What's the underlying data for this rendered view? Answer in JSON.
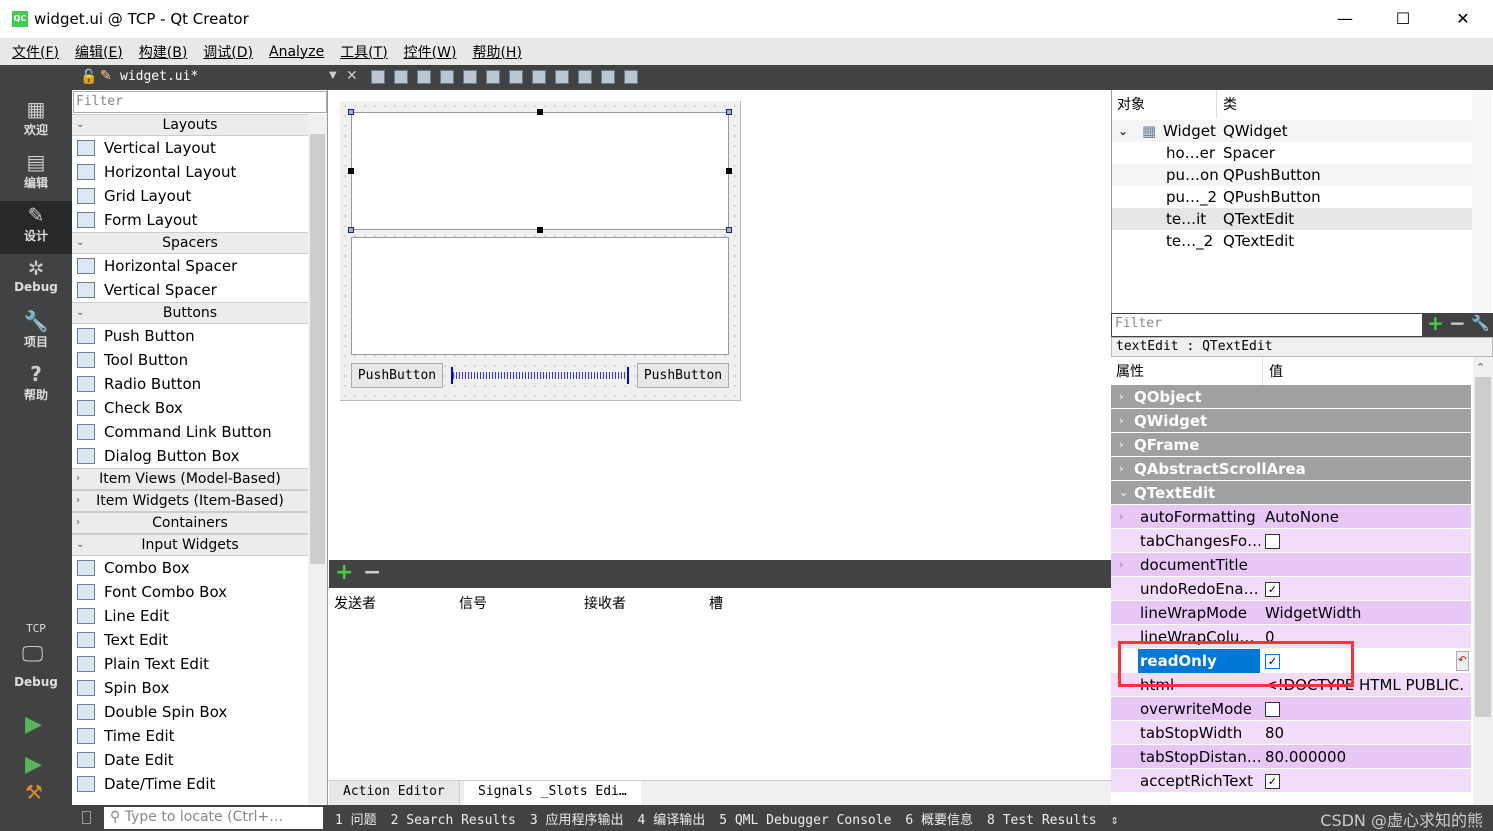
{
  "window": {
    "title": "widget.ui @ TCP - Qt Creator",
    "logo": "QC",
    "minimize": "—",
    "maximize": "☐",
    "close": "✕"
  },
  "menu": [
    "文件(F)",
    "编辑(E)",
    "构建(B)",
    "调试(D)",
    "Analyze",
    "工具(T)",
    "控件(W)",
    "帮助(H)"
  ],
  "toolbar": {
    "file": "widget.ui*",
    "close": "✕"
  },
  "modes": [
    {
      "label": "欢迎",
      "icon": "grid-icon",
      "glyph": "▦"
    },
    {
      "label": "编辑",
      "icon": "edit-icon",
      "glyph": "▤"
    },
    {
      "label": "设计",
      "icon": "pencil-icon",
      "glyph": "✎",
      "active": true
    },
    {
      "label": "Debug",
      "icon": "bug-icon",
      "glyph": "✲"
    },
    {
      "label": "项目",
      "icon": "wrench-icon",
      "glyph": "🔧"
    },
    {
      "label": "帮助",
      "icon": "help-icon",
      "glyph": "?"
    }
  ],
  "kit": {
    "project": "TCP",
    "config": "Debug"
  },
  "widgetbox": {
    "filter_placeholder": "Filter",
    "sections": [
      {
        "title": "Layouts",
        "items": [
          "Vertical Layout",
          "Horizontal Layout",
          "Grid Layout",
          "Form Layout"
        ]
      },
      {
        "title": "Spacers",
        "items": [
          "Horizontal Spacer",
          "Vertical Spacer"
        ]
      },
      {
        "title": "Buttons",
        "items": [
          "Push Button",
          "Tool Button",
          "Radio Button",
          "Check Box",
          "Command Link Button",
          "Dialog Button Box"
        ]
      },
      {
        "title": "Item Views (Model-Based)",
        "collapsed": true,
        "items": []
      },
      {
        "title": "Item Widgets (Item-Based)",
        "collapsed": true,
        "items": []
      },
      {
        "title": "Containers",
        "collapsed": true,
        "items": []
      },
      {
        "title": "Input Widgets",
        "items": [
          "Combo Box",
          "Font Combo Box",
          "Line Edit",
          "Text Edit",
          "Plain Text Edit",
          "Spin Box",
          "Double Spin Box",
          "Time Edit",
          "Date Edit",
          "Date/Time Edit"
        ]
      }
    ]
  },
  "form": {
    "button1": "PushButton",
    "button2": "PushButton"
  },
  "signals": {
    "columns": [
      "发送者",
      "信号",
      "接收者",
      "槽"
    ],
    "tabs": [
      "Action Editor",
      "Signals _Slots Edi…"
    ]
  },
  "objects": {
    "columns": [
      "对象",
      "类"
    ],
    "rows": [
      {
        "name": "Widget",
        "cls": "QWidget"
      },
      {
        "name": "ho…er",
        "cls": "Spacer"
      },
      {
        "name": "pu…on",
        "cls": "QPushButton"
      },
      {
        "name": "pu…_2",
        "cls": "QPushButton"
      },
      {
        "name": "te…it",
        "cls": "QTextEdit",
        "selected": true
      },
      {
        "name": "te…_2",
        "cls": "QTextEdit"
      }
    ]
  },
  "properties": {
    "filter_placeholder": "Filter",
    "class_label": "textEdit : QTextEdit",
    "columns": [
      "属性",
      "值"
    ],
    "groups": [
      "QObject",
      "QWidget",
      "QFrame",
      "QAbstractScrollArea",
      "QTextEdit"
    ],
    "rows": [
      {
        "k": "autoFormatting",
        "v": "AutoNone",
        "expand": true
      },
      {
        "k": "tabChangesFo…",
        "check": false
      },
      {
        "k": "documentTitle",
        "v": "",
        "expand": true
      },
      {
        "k": "undoRedoEna…",
        "check": true
      },
      {
        "k": "lineWrapMode",
        "v": "WidgetWidth"
      },
      {
        "k": "lineWrapColu…",
        "v": "0"
      },
      {
        "k": "readOnly",
        "check": true,
        "selected": true
      },
      {
        "k": "html",
        "v": "<!DOCTYPE HTML PUBLIC…",
        "expand": true
      },
      {
        "k": "overwriteMode",
        "check": false
      },
      {
        "k": "tabStopWidth",
        "v": "80"
      },
      {
        "k": "tabStopDistan…",
        "v": "80.000000"
      },
      {
        "k": "acceptRichText",
        "check": true
      }
    ]
  },
  "colors": {
    "highlight": "#e8c6f8",
    "highlight_alt": "#f2dcfb",
    "group": "#a0a0a0",
    "selection": "#0078d7",
    "annotation": "#ff3333"
  },
  "status": {
    "locator_placeholder": "Type to locate (Ctrl+…",
    "tabs": [
      "1 问题",
      "2 Search Results",
      "3 应用程序输出",
      "4 编译输出",
      "5 QML Debugger Console",
      "6 概要信息",
      "8 Test Results"
    ]
  },
  "watermark": "CSDN @虚心求知的熊"
}
